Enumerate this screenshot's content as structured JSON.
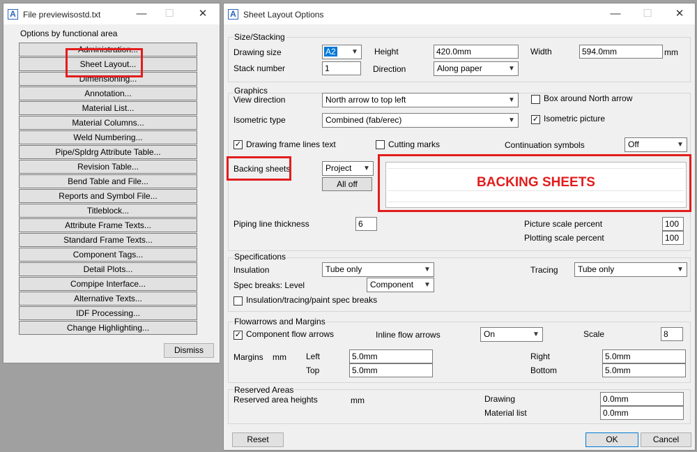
{
  "left_window": {
    "title": "File previewisostd.txt",
    "controls": {
      "minimize": "—",
      "maximize": "☐",
      "close": "✕"
    },
    "section_label": "Options by functional area",
    "buttons": [
      "Administration...",
      "Sheet Layout...",
      "Dimensioning...",
      "Annotation...",
      "Material List...",
      "Material Columns...",
      "Weld Numbering...",
      "Pipe/Spldrg Attribute Table...",
      "Revision Table...",
      "Bend Table and File...",
      "Reports and Symbol File...",
      "Titleblock...",
      "Attribute Frame Texts...",
      "Standard Frame Texts...",
      "Component Tags...",
      "Detail Plots...",
      "Compipe Interface...",
      "Alternative Texts...",
      "IDF Processing...",
      "Change Highlighting..."
    ],
    "dismiss_label": "Dismiss"
  },
  "dialog": {
    "title": "Sheet Layout Options",
    "controls": {
      "minimize": "—",
      "maximize": "☐",
      "close": "✕"
    },
    "size_stacking": {
      "title": "Size/Stacking",
      "drawing_size_label": "Drawing size",
      "drawing_size_value": "A2",
      "height_label": "Height",
      "height_value": "420.0mm",
      "width_label": "Width",
      "width_value": "594.0mm",
      "width_unit": "mm",
      "stack_number_label": "Stack number",
      "stack_number_value": "1",
      "direction_label": "Direction",
      "direction_value": "Along paper"
    },
    "graphics": {
      "title": "Graphics",
      "view_direction_label": "View direction",
      "view_direction_value": "North arrow to top left",
      "box_north_arrow_label": "Box around North arrow",
      "isometric_type_label": "Isometric type",
      "isometric_type_value": "Combined (fab/erec)",
      "isometric_picture_label": "Isometric picture",
      "frame_lines_label": "Drawing frame lines  text",
      "cutting_marks_label": "Cutting marks",
      "continuation_label": "Continuation symbols",
      "continuation_value": "Off",
      "backing_sheets_label": "Backing sheets",
      "backing_sheets_value": "Project",
      "all_off_label": "All off",
      "backing_preview_text": "BACKING SHEETS",
      "piping_thickness_label": "Piping line thickness",
      "piping_thickness_value": "6",
      "picture_scale_label": "Picture scale percent",
      "picture_scale_value": "100",
      "plotting_scale_label": "Plotting scale percent",
      "plotting_scale_value": "100"
    },
    "specifications": {
      "title": "Specifications",
      "insulation_label": "Insulation",
      "insulation_value": "Tube only",
      "tracing_label": "Tracing",
      "tracing_value": "Tube only",
      "spec_breaks_label": "Spec breaks:  Level",
      "spec_breaks_value": "Component",
      "ins_trace_paint_label": "Insulation/tracing/paint spec breaks"
    },
    "flowarrows": {
      "title": "Flowarrows and Margins",
      "component_flow_label": "Component flow arrows",
      "inline_flow_label": "Inline flow arrows",
      "inline_flow_value": "On",
      "scale_label": "Scale",
      "scale_value": "8",
      "margins_label": "Margins",
      "margins_unit": "mm",
      "left_label": "Left",
      "left_value": "5.0mm",
      "top_label": "Top",
      "top_value": "5.0mm",
      "right_label": "Right",
      "right_value": "5.0mm",
      "bottom_label": "Bottom",
      "bottom_value": "5.0mm"
    },
    "reserved": {
      "title": "Reserved Areas",
      "heights_label": "Reserved area heights",
      "unit": "mm",
      "drawing_label": "Drawing",
      "drawing_value": "0.0mm",
      "material_list_label": "Material list",
      "material_list_value": "0.0mm"
    },
    "reset_label": "Reset",
    "ok_label": "OK",
    "cancel_label": "Cancel"
  },
  "highlight_color": "#e21d1d",
  "accent_color": "#0078d7"
}
